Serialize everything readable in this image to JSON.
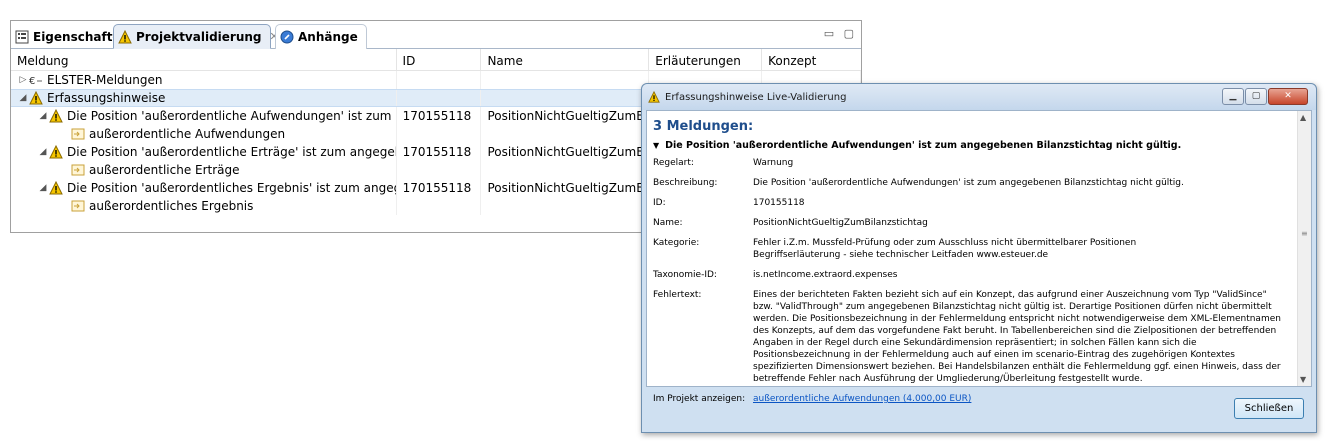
{
  "tabs": [
    {
      "label": "Eigenschaften",
      "icon": "properties-icon"
    },
    {
      "label": "Projektvalidierung",
      "icon": "warning-icon",
      "close": "✕"
    },
    {
      "label": "Anhänge",
      "icon": "attachment-icon"
    }
  ],
  "table": {
    "columns": [
      "Meldung",
      "ID",
      "Name",
      "Erläuterungen",
      "Konzept"
    ],
    "rows": [
      {
        "level": 0,
        "expander": "▷",
        "icon": "elster-icon",
        "message": "ELSTER-Meldungen",
        "id": "",
        "name": ""
      },
      {
        "level": 0,
        "expander": "◢",
        "icon": "warning-icon",
        "message": "Erfassungshinweise",
        "id": "",
        "name": "",
        "selected": true
      },
      {
        "level": 1,
        "expander": "◢",
        "icon": "warning-icon",
        "message": "Die Position 'außerordentliche Aufwendungen' ist zum angegebenen Bilanzstichtag nicht gültig.",
        "id": "170155118",
        "name": "PositionNichtGueltigZumBilanzstichtag"
      },
      {
        "level": 2,
        "expander": "",
        "icon": "concept-icon",
        "message": "außerordentliche Aufwendungen",
        "id": "",
        "name": ""
      },
      {
        "level": 1,
        "expander": "◢",
        "icon": "warning-icon",
        "message": "Die Position 'außerordentliche Erträge' ist zum angegebenen Bilanzstichtag nicht gültig.",
        "id": "170155118",
        "name": "PositionNichtGueltigZumBilanzstichtag"
      },
      {
        "level": 2,
        "expander": "",
        "icon": "concept-icon",
        "message": "außerordentliche Erträge",
        "id": "",
        "name": ""
      },
      {
        "level": 1,
        "expander": "◢",
        "icon": "warning-icon",
        "message": "Die Position 'außerordentliches Ergebnis' ist zum angegebenen Bilanzstichtag nicht gültig.",
        "id": "170155118",
        "name": "PositionNichtGueltigZumBilanzstichtag"
      },
      {
        "level": 2,
        "expander": "",
        "icon": "concept-icon",
        "message": "außerordentliches Ergebnis",
        "id": "",
        "name": ""
      }
    ]
  },
  "dialog": {
    "title": "Erfassungshinweise Live-Validierung",
    "count_title": "3 Meldungen:",
    "message_header": "Die Position 'außerordentliche Aufwendungen' ist zum angegebenen Bilanzstichtag nicht gültig.",
    "details": [
      {
        "key": "Regelart:",
        "value": "Warnung"
      },
      {
        "key": "Beschreibung:",
        "value": "Die Position 'außerordentliche Aufwendungen' ist zum angegebenen Bilanzstichtag nicht gültig."
      },
      {
        "key": "ID:",
        "value": "170155118"
      },
      {
        "key": "Name:",
        "value": "PositionNichtGueltigZumBilanzstichtag"
      },
      {
        "key": "Kategorie:",
        "value": "Fehler i.Z.m. Mussfeld-Prüfung oder zum Ausschluss nicht übermittelbarer Positionen",
        "value2": "Begriffserläuterung - siehe technischer Leitfaden www.esteuer.de"
      },
      {
        "key": "Taxonomie-ID:",
        "value": "is.netIncome.extraord.expenses"
      },
      {
        "key": "Fehlertext:",
        "value": "Eines der berichteten Fakten bezieht sich auf ein Konzept, das aufgrund einer Auszeichnung vom Typ \"ValidSince\" bzw. \"ValidThrough\" zum angegebenen Bilanzstichtag nicht gültig ist. Derartige Positionen dürfen nicht übermittelt werden. Die Positionsbezeichnung in der Fehlermeldung entspricht nicht notwendigerweise dem XML-Elementnamen des Konzepts, auf dem das vorgefundene Fakt beruht. In Tabellenbereichen sind die Zielpositionen der betreffenden Angaben in der Regel durch eine Sekundärdimension repräsentiert; in solchen Fällen kann sich die Positionsbezeichnung in der Fehlermeldung auch auf einen im scenario-Eintrag des zugehörigen Kontextes spezifizierten Dimensionswert beziehen. Bei Handelsbilanzen enthält die Fehlermeldung ggf. einen Hinweis, dass der betreffende Fehler nach Ausführung der Umgliederung/Überleitung festgestellt wurde."
      }
    ],
    "project_link_label": "Im Projekt anzeigen:",
    "project_link": "außerordentliche Aufwendungen (4.000,00 EUR)",
    "close_button": "Schließen"
  }
}
